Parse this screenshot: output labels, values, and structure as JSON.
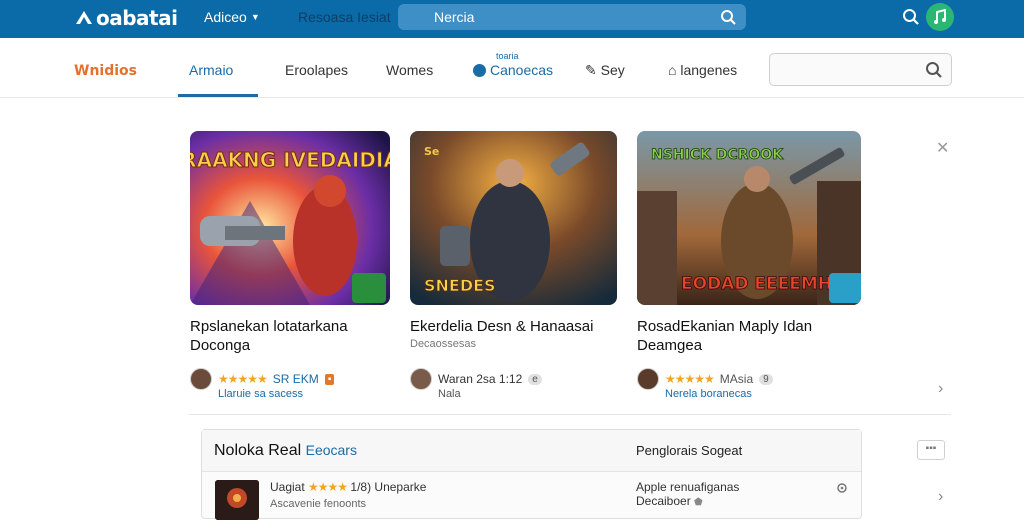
{
  "topbar": {
    "logo": "oabatai",
    "menu": "Adiceo",
    "label": "Resoasa Iesiat",
    "search_placeholder": "Nercia"
  },
  "subnav": {
    "brand": "Wnidios",
    "tabs": [
      "Armaio",
      "Eroolapes",
      "Womes",
      "Canoecas",
      "Sey",
      "langenes"
    ],
    "active_tab": "Armaio",
    "badge_small": "toaria"
  },
  "cards": [
    {
      "art_text": "RAAKNG IVEDAIDIA",
      "title": "Rpslanekan lotatarkana",
      "title2": "Doconga",
      "rating_text": "SR EKM",
      "developer": "Llaruie sa sacess",
      "corner_icon": "controller-icon"
    },
    {
      "art_text": "SNEDES",
      "title": "Ekerdelia Desn & Hanaasai",
      "subtitle": "Decaossesas",
      "rating_text": "Waran 2sa 1:12",
      "developer": "Nala",
      "pill": "e"
    },
    {
      "art_text": "EODAD EEEEMHAT",
      "art_top": "NSHICK DCROOK",
      "title": "RosadEkanian Maply Idan",
      "title2": "Deamgea",
      "rating_text": "MAsia",
      "developer": "Nerela boranecas",
      "pill": "9"
    }
  ],
  "panel": {
    "title": "Noloka Real",
    "title_blue": "Eeocars",
    "right": "Penglorais Sogeat",
    "row_name": "Uagiat",
    "row_rating": "1/8) Uneparke",
    "row_sub": "Ascavenie fenoonts",
    "row_r1": "Apple renuafiganas",
    "row_r2": "Decaiboer",
    "more": "▪▪▪"
  },
  "colors": {
    "topbar": "#0b6aa8",
    "accent": "#1a6ba6",
    "brand_orange": "#e2722d",
    "star": "#f4a423"
  }
}
